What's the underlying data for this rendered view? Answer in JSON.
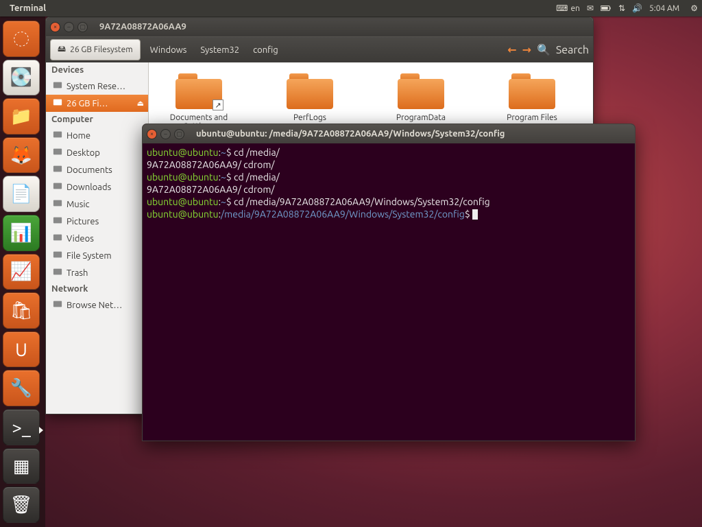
{
  "top_panel": {
    "app_title": "Terminal",
    "lang": "en",
    "time": "5:04 AM"
  },
  "launcher": {
    "tiles": [
      {
        "name": "dash",
        "glyph": "◌"
      },
      {
        "name": "disk-utility",
        "glyph": "💽"
      },
      {
        "name": "files",
        "glyph": "📁"
      },
      {
        "name": "firefox",
        "glyph": "🦊"
      },
      {
        "name": "writer",
        "glyph": "📄"
      },
      {
        "name": "calc",
        "glyph": "📊"
      },
      {
        "name": "impress",
        "glyph": "📈"
      },
      {
        "name": "software-center",
        "glyph": "🛍"
      },
      {
        "name": "ubuntu-one",
        "glyph": "U"
      },
      {
        "name": "settings",
        "glyph": "🔧"
      },
      {
        "name": "terminal",
        "glyph": ">_"
      },
      {
        "name": "workspaces",
        "glyph": "▦"
      },
      {
        "name": "trash",
        "glyph": "🗑"
      }
    ]
  },
  "nautilus": {
    "title": "9A72A08872A06AA9",
    "breadcrumbs": {
      "root": "26 GB Filesystem",
      "parts": [
        "Windows",
        "System32",
        "config"
      ]
    },
    "search_label": "Search",
    "sidebar": {
      "sections": [
        {
          "title": "Devices",
          "items": [
            {
              "label": "System Rese…",
              "icon": "drive"
            },
            {
              "label": "26 GB Fi…",
              "icon": "drive",
              "active": true,
              "eject": true
            }
          ]
        },
        {
          "title": "Computer",
          "items": [
            {
              "label": "Home",
              "icon": "home"
            },
            {
              "label": "Desktop",
              "icon": "desktop"
            },
            {
              "label": "Documents",
              "icon": "folder"
            },
            {
              "label": "Downloads",
              "icon": "folder"
            },
            {
              "label": "Music",
              "icon": "folder"
            },
            {
              "label": "Pictures",
              "icon": "folder"
            },
            {
              "label": "Videos",
              "icon": "folder"
            },
            {
              "label": "File System",
              "icon": "drive"
            },
            {
              "label": "Trash",
              "icon": "trash"
            }
          ]
        },
        {
          "title": "Network",
          "items": [
            {
              "label": "Browse Net…",
              "icon": "network"
            }
          ]
        }
      ]
    },
    "files": [
      {
        "label": "Documents and Settings",
        "shortcut": true
      },
      {
        "label": "PerfLogs"
      },
      {
        "label": "ProgramData"
      },
      {
        "label": "Program Files"
      }
    ]
  },
  "terminal": {
    "title": "ubuntu@ubuntu: /media/9A72A08872A06AA9/Windows/System32/config",
    "lines": [
      {
        "prompt_user": "ubuntu@ubuntu",
        "prompt_path": "~",
        "cmd": "cd /media/"
      },
      {
        "plain": "9A72A08872A06AA9/ cdrom/"
      },
      {
        "prompt_user": "ubuntu@ubuntu",
        "prompt_path": "~",
        "cmd": "cd /media/"
      },
      {
        "plain": "9A72A08872A06AA9/ cdrom/"
      },
      {
        "prompt_user": "ubuntu@ubuntu",
        "prompt_path": "~",
        "cmd": "cd /media/9A72A08872A06AA9/Windows/System32/config"
      },
      {
        "prompt_user": "ubuntu@ubuntu",
        "prompt_path": "/media/9A72A08872A06AA9/Windows/System32/config",
        "cmd": "",
        "cursor": true
      }
    ]
  }
}
